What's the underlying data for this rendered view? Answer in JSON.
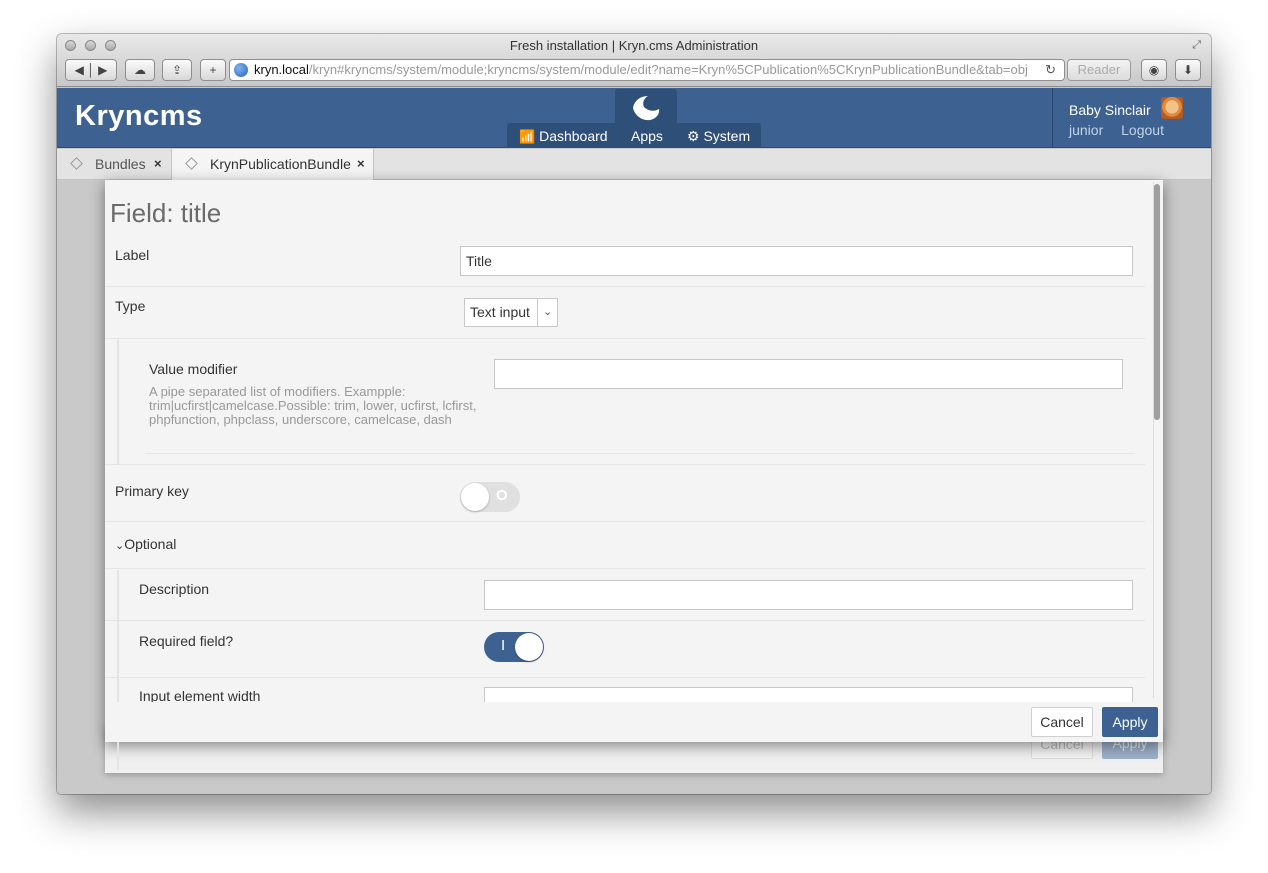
{
  "browser": {
    "window_title": "Fresh installation | Kryn.cms Administration",
    "url_host": "kryn.local",
    "url_path": "/kryn#kryncms/system/module;kryncms/system/module/edit?name=Kryn%5CPublication%5CKrynPublicationBundle&tab=obj",
    "reader_label": "Reader"
  },
  "header": {
    "logo": "Kryncms",
    "nav": {
      "dashboard": "Dashboard",
      "apps": "Apps",
      "system": "System"
    },
    "user": {
      "name": "Baby Sinclair",
      "link_account": "junior",
      "link_logout": "Logout"
    }
  },
  "tabs": [
    {
      "label": "Bundles",
      "close": "×"
    },
    {
      "label": "KrynPublicationBundle",
      "close": "×"
    }
  ],
  "dialog": {
    "title": "Field: title",
    "label_field": {
      "label": "Label",
      "value": "Title"
    },
    "type_field": {
      "label": "Type",
      "selected": "Text input"
    },
    "value_modifier": {
      "label": "Value modifier",
      "description": "A pipe separated list of modifiers. Exampple: trim|ucfirst|camelcase.Possible: trim, lower, ucfirst, lcfirst, phpfunction, phpclass, underscore, camelcase, dash",
      "value": ""
    },
    "primary_key": {
      "label": "Primary key",
      "state": "O"
    },
    "optional": {
      "label": "Optional"
    },
    "description_field": {
      "label": "Description",
      "value": ""
    },
    "required_field": {
      "label": "Required field?",
      "state": "I"
    },
    "input_width": {
      "label": "Input element width"
    },
    "buttons": {
      "cancel": "Cancel",
      "apply": "Apply"
    }
  },
  "colors": {
    "brand": "#3d6292",
    "header_dark": "#2e4f78"
  }
}
